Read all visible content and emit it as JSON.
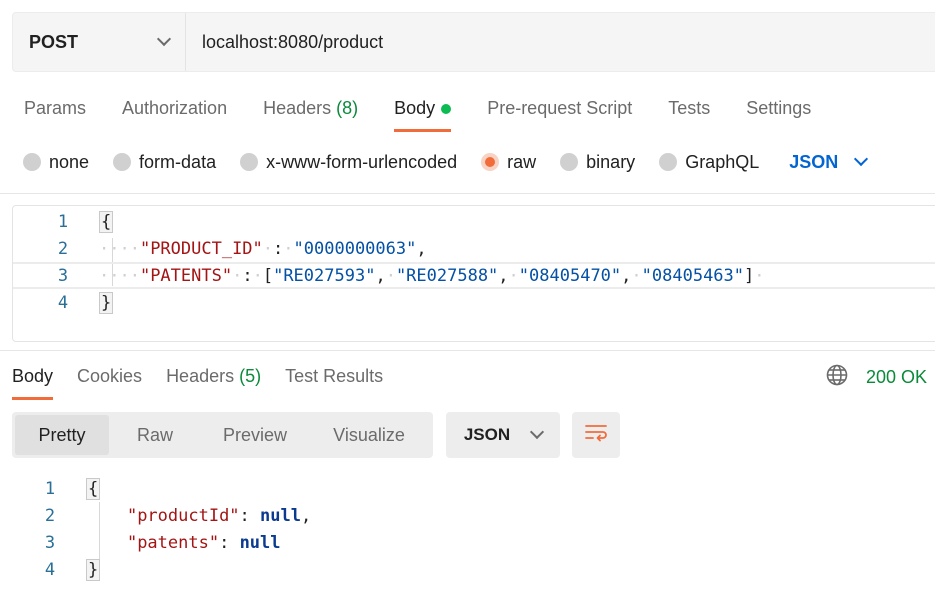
{
  "request": {
    "method": "POST",
    "url": "localhost:8080/product"
  },
  "request_tabs": [
    {
      "label": "Params"
    },
    {
      "label": "Authorization"
    },
    {
      "label": "Headers",
      "count": "(8)"
    },
    {
      "label": "Body"
    },
    {
      "label": "Pre-request Script"
    },
    {
      "label": "Tests"
    },
    {
      "label": "Settings"
    }
  ],
  "body_types": [
    {
      "label": "none"
    },
    {
      "label": "form-data"
    },
    {
      "label": "x-www-form-urlencoded"
    },
    {
      "label": "raw"
    },
    {
      "label": "binary"
    },
    {
      "label": "GraphQL"
    }
  ],
  "body_format": "JSON",
  "request_body": {
    "line_numbers": [
      "1",
      "2",
      "3",
      "4"
    ],
    "open_brace": "{",
    "close_brace": "}",
    "key1": "\"PRODUCT_ID\"",
    "colon1": ":",
    "value1": "\"0000000063\"",
    "comma1": ",",
    "key2": "\"PATENTS\"",
    "colon2": ":",
    "open_bracket": "[",
    "patents": [
      "\"RE027593\"",
      "\"RE027588\"",
      "\"08405470\"",
      "\"08405463\""
    ],
    "close_bracket": "]"
  },
  "response_tabs": [
    {
      "label": "Body"
    },
    {
      "label": "Cookies"
    },
    {
      "label": "Headers",
      "count": "(5)"
    },
    {
      "label": "Test Results"
    }
  ],
  "status": "200 OK",
  "view_modes": [
    "Pretty",
    "Raw",
    "Preview",
    "Visualize"
  ],
  "response_format": "JSON",
  "response_body": {
    "line_numbers": [
      "1",
      "2",
      "3",
      "4"
    ],
    "open_brace": "{",
    "close_brace": "}",
    "key1": "\"productId\"",
    "value1": "null",
    "key2": "\"patents\"",
    "value2": "null"
  },
  "colors": {
    "accent": "#f26b3a",
    "status_ok": "#0a8a3a",
    "json_blue": "#0265d2",
    "key_red": "#a31515",
    "string_blue": "#0451a5"
  },
  "icons": {
    "method_dropdown": "chevron-down-icon",
    "globe": "globe-icon",
    "wrap": "wrap-lines-icon"
  }
}
